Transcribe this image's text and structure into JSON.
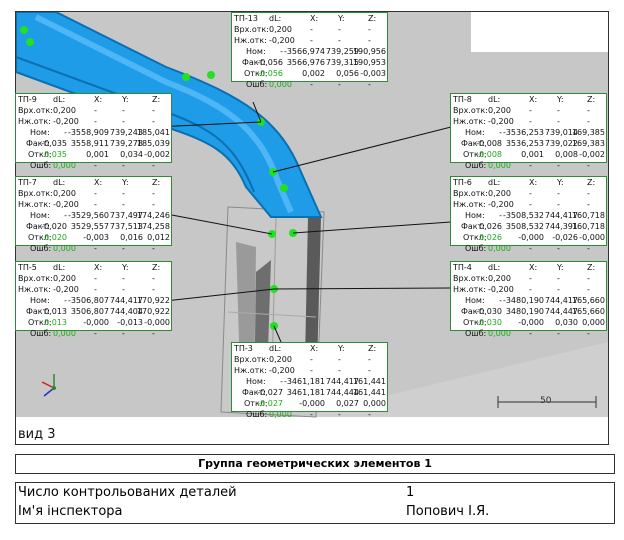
{
  "view": {
    "label": "вид 3",
    "scale_label": "50"
  },
  "boxes": [
    {
      "id": "tp13",
      "title": "ТП-13",
      "vrh": "0,200",
      "nzh": "-0,200",
      "nom": [
        "-3566,974",
        "739,259",
        "190,956"
      ],
      "fakt": [
        "-0,056",
        "3566,976",
        "739,315",
        "190,953"
      ],
      "otkl": [
        "-0,056",
        "0,002",
        "0,056",
        "-0,003"
      ],
      "oshb": "0,000"
    },
    {
      "id": "tp9",
      "title": "ТП-9",
      "vrh": "0,200",
      "nzh": "-0,200",
      "nom": [
        "-3558,909",
        "739,243",
        "185,041"
      ],
      "fakt": [
        "-0,035",
        "3558,911",
        "739,278",
        "185,039"
      ],
      "otkl": [
        "0,035",
        "0,001",
        "0,034",
        "-0,002"
      ],
      "oshb": "0,000"
    },
    {
      "id": "tp8",
      "title": "ТП-8",
      "vrh": "0,200",
      "nzh": "-0,200",
      "nom": [
        "-3536,253",
        "739,014",
        "169,385"
      ],
      "fakt": [
        "-0,008",
        "3536,253",
        "739,022",
        "169,383"
      ],
      "otkl": [
        "-0,008",
        "0,001",
        "0,008",
        "-0,002"
      ],
      "oshb": "0,000"
    },
    {
      "id": "tp7",
      "title": "ТП-7",
      "vrh": "0,200",
      "nzh": "-0,200",
      "nom": [
        "-3529,560",
        "737,497",
        "174,246"
      ],
      "fakt": [
        "-0,020",
        "3529,557",
        "737,513",
        "174,258"
      ],
      "otkl": [
        "0,020",
        "-0,003",
        "0,016",
        "0,012"
      ],
      "oshb": "0,000"
    },
    {
      "id": "tp6",
      "title": "ТП-6",
      "vrh": "0,200",
      "nzh": "-0,200",
      "nom": [
        "-3508,532",
        "744,417",
        "160,718"
      ],
      "fakt": [
        "0,026",
        "3508,532",
        "744,391",
        "160,718"
      ],
      "otkl": [
        "0,026",
        "-0,000",
        "-0,026",
        "-0,000"
      ],
      "oshb": "0,000"
    },
    {
      "id": "tp5",
      "title": "ТП-5",
      "vrh": "0,200",
      "nzh": "-0,200",
      "nom": [
        "-3506,807",
        "744,417",
        "170,922"
      ],
      "fakt": [
        "0,013",
        "3506,807",
        "744,404",
        "170,922"
      ],
      "otkl": [
        "0,013",
        "-0,000",
        "-0,013",
        "-0,000"
      ],
      "oshb": "0,000"
    },
    {
      "id": "tp4",
      "title": "ТП-4",
      "vrh": "0,200",
      "nzh": "-0,200",
      "nom": [
        "-3480,190",
        "744,417",
        "165,660"
      ],
      "fakt": [
        "-0,030",
        "3480,190",
        "744,447",
        "165,660"
      ],
      "otkl": [
        "-0,030",
        "-0,000",
        "0,030",
        "0,000"
      ],
      "oshb": "0,000"
    },
    {
      "id": "tp3",
      "title": "ТП-3",
      "vrh": "0,200",
      "nzh": "-0,200",
      "nom": [
        "-3461,181",
        "744,417",
        "161,441"
      ],
      "fakt": [
        "-0,027",
        "3461,181",
        "744,444",
        "161,441"
      ],
      "otkl": [
        "-0,027",
        "-0,000",
        "0,027",
        "0,000"
      ],
      "oshb": "0,000"
    }
  ],
  "labels": {
    "dl": "dL:",
    "x": "X:",
    "y": "Y:",
    "z": "Z:",
    "vrh": "Врх.отк:",
    "nzh": "Нж.отк:",
    "nom": "Ном:",
    "fakt": "Факт:",
    "otkl": "Откл:",
    "oshb": "Ошб:",
    "dash": "-"
  },
  "group_title": "Группа геометрических элементов 1",
  "info": [
    {
      "key": "Число контрольованих деталей",
      "value": "1"
    },
    {
      "key": "Ім'я інспектора",
      "value": "Попович І.Я."
    }
  ]
}
